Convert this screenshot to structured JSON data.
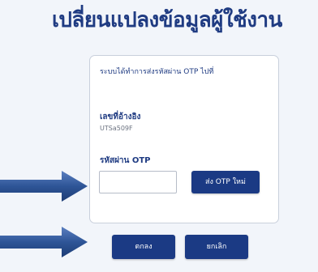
{
  "page": {
    "title": "เปลี่ยนแปลงข้อมูลผู้ใช้งาน"
  },
  "otp_card": {
    "notice": "ระบบได้ทำการส่งรหัสผ่าน OTP ไปที่",
    "reference_label": "เลขที่อ้างอิง",
    "reference_value": "UTSa509F",
    "otp_label": "รหัสผ่าน OTP",
    "otp_value": "",
    "resend_label": "ส่ง OTP ใหม่"
  },
  "actions": {
    "confirm_label": "ตกลง",
    "cancel_label": "ยกเลิก"
  },
  "annotations": {
    "arrow_icon": "right-arrow-icon",
    "arrow_color": "#2e5597"
  },
  "colors": {
    "title": "#1f3b82",
    "button": "#1b3a84",
    "background": "#f2f5fa"
  }
}
